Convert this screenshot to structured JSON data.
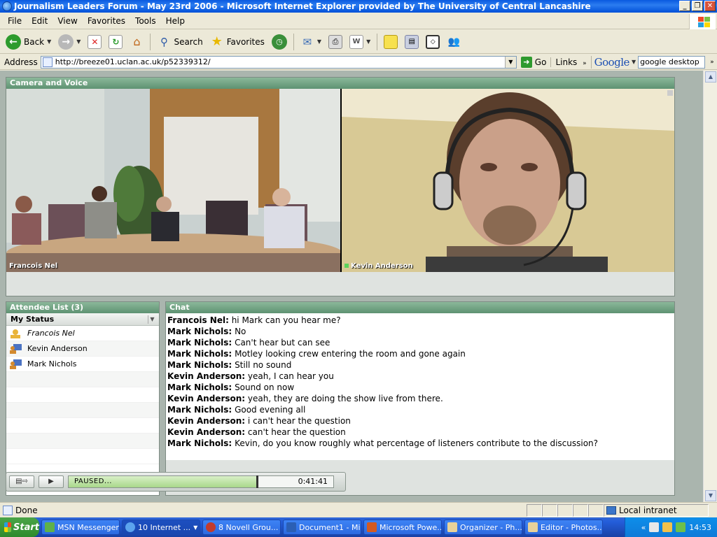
{
  "window": {
    "title": "Journalism Leaders Forum - May 23rd 2006 - Microsoft Internet Explorer provided by The University of Central Lancashire",
    "min": "_",
    "max": "❐",
    "close": "✕"
  },
  "menu": [
    "File",
    "Edit",
    "View",
    "Favorites",
    "Tools",
    "Help"
  ],
  "toolbar": {
    "back": "Back",
    "search": "Search",
    "favorites": "Favorites"
  },
  "address": {
    "label": "Address",
    "url": "http://breeze01.uclan.ac.uk/p52339312/",
    "go": "Go",
    "links": "Links",
    "google_logo": "Google",
    "google_query": "google desktop"
  },
  "camera": {
    "title": "Camera and Voice",
    "feed1_name": "Francois Nel",
    "feed2_name": "Kevin Anderson"
  },
  "attendees": {
    "title": "Attendee List (3)",
    "status_label": "My Status",
    "items": [
      {
        "name": "Francois Nel"
      },
      {
        "name": "Kevin Anderson"
      },
      {
        "name": "Mark Nichols"
      }
    ]
  },
  "chat": {
    "title": "Chat",
    "messages": [
      {
        "from": "Francois Nel:",
        "text": "hi Mark can you hear me?"
      },
      {
        "from": "Mark Nichols:",
        "text": "No"
      },
      {
        "from": "Mark Nichols:",
        "text": "Can't hear but can see"
      },
      {
        "from": "Mark Nichols:",
        "text": "Motley looking crew entering the room and gone again"
      },
      {
        "from": "Mark Nichols:",
        "text": "Still no sound"
      },
      {
        "from": "Kevin Anderson:",
        "text": "yeah, I can hear you"
      },
      {
        "from": "Mark Nichols:",
        "text": "Sound on now"
      },
      {
        "from": "Kevin Anderson:",
        "text": "yeah, they are doing the show live from there."
      },
      {
        "from": "Mark Nichols:",
        "text": "Good evening all"
      },
      {
        "from": "Kevin Anderson:",
        "text": "i can't hear the question"
      },
      {
        "from": "Kevin Anderson:",
        "text": "can't hear the question"
      },
      {
        "from": "Mark Nichols:",
        "text": "Kevin, do you know roughly what percentage of listeners contribute to the discussion?"
      }
    ]
  },
  "playback": {
    "state": "PAUSED...",
    "time": "0:41:41",
    "progress": 0.71
  },
  "status": {
    "text": "Done",
    "zone": "Local intranet"
  },
  "taskbar": {
    "start": "Start",
    "tasks": [
      "MSN Messenger",
      "10 Internet ...",
      "8 Novell Grou...",
      "Document1 - Mi...",
      "Microsoft Powe...",
      "Organizer - Ph...",
      "Editor - Photos..."
    ],
    "clock": "14:53"
  }
}
